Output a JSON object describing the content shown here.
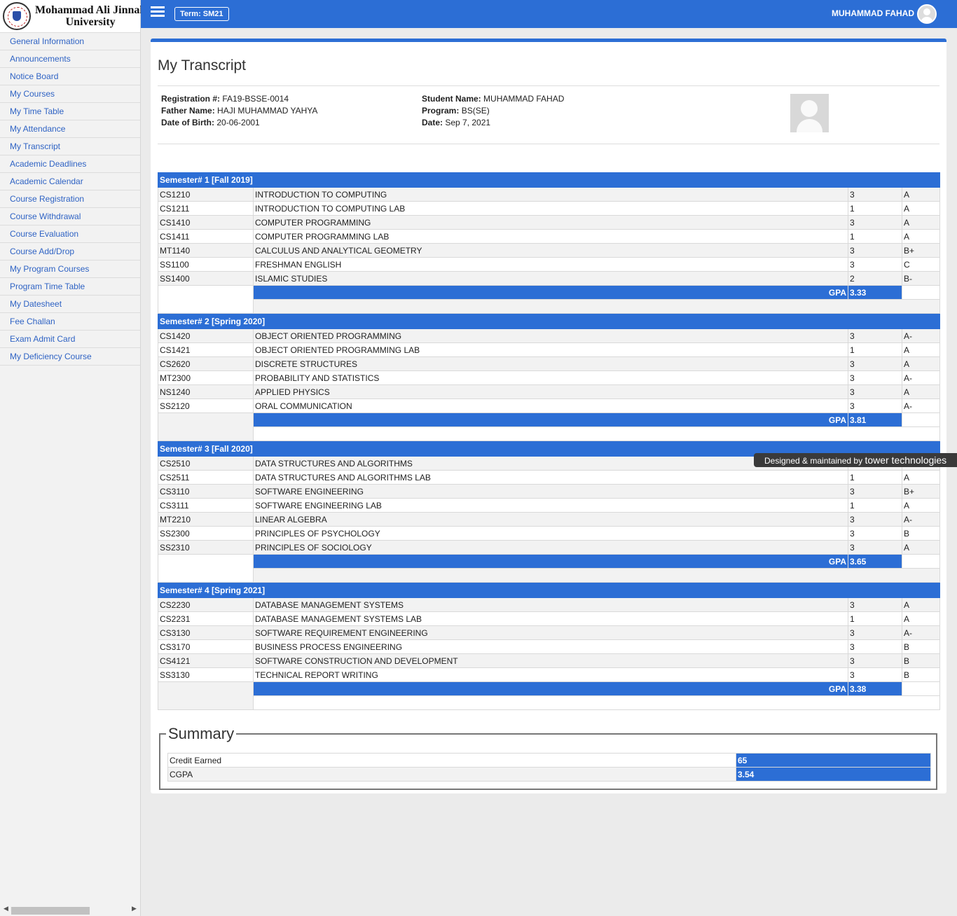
{
  "university": {
    "line1": "Mohammad Ali Jinnah",
    "line2": "University"
  },
  "sidebar": {
    "items": [
      {
        "label": "General Information"
      },
      {
        "label": "Announcements"
      },
      {
        "label": "Notice Board"
      },
      {
        "label": "My Courses"
      },
      {
        "label": "My Time Table"
      },
      {
        "label": "My Attendance"
      },
      {
        "label": "My Transcript"
      },
      {
        "label": "Academic Deadlines"
      },
      {
        "label": "Academic Calendar"
      },
      {
        "label": "Course Registration"
      },
      {
        "label": "Course Withdrawal"
      },
      {
        "label": "Course Evaluation"
      },
      {
        "label": "Course Add/Drop"
      },
      {
        "label": "My Program Courses"
      },
      {
        "label": "Program Time Table"
      },
      {
        "label": "My Datesheet"
      },
      {
        "label": "Fee Challan"
      },
      {
        "label": "Exam Admit Card"
      },
      {
        "label": "My Deficiency Course"
      }
    ]
  },
  "topbar": {
    "term": "Term: SM21",
    "user": "MUHAMMAD FAHAD"
  },
  "page": {
    "title": "My Transcript"
  },
  "student": {
    "reg_label": "Registration #:",
    "reg": "FA19-BSSE-0014",
    "father_label": "Father Name:",
    "father": "HAJI MUHAMMAD YAHYA",
    "dob_label": "Date of Birth:",
    "dob": "20-06-2001",
    "name_label": "Student Name:",
    "name": "MUHAMMAD FAHAD",
    "program_label": "Program:",
    "program": "BS(SE)",
    "date_label": "Date:",
    "date": "Sep 7, 2021"
  },
  "gpa_label": "GPA",
  "semesters": [
    {
      "title": "Semester# 1 [Fall 2019]",
      "gpa": "3.33",
      "courses": [
        {
          "code": "CS1210",
          "name": "INTRODUCTION TO COMPUTING",
          "cr": "3",
          "grade": "A"
        },
        {
          "code": "CS1211",
          "name": "INTRODUCTION TO COMPUTING LAB",
          "cr": "1",
          "grade": "A"
        },
        {
          "code": "CS1410",
          "name": "COMPUTER PROGRAMMING",
          "cr": "3",
          "grade": "A"
        },
        {
          "code": "CS1411",
          "name": "COMPUTER PROGRAMMING LAB",
          "cr": "1",
          "grade": "A"
        },
        {
          "code": "MT1140",
          "name": "CALCULUS AND ANALYTICAL GEOMETRY",
          "cr": "3",
          "grade": "B+"
        },
        {
          "code": "SS1100",
          "name": "FRESHMAN ENGLISH",
          "cr": "3",
          "grade": "C"
        },
        {
          "code": "SS1400",
          "name": "ISLAMIC STUDIES",
          "cr": "2",
          "grade": "B-"
        }
      ]
    },
    {
      "title": "Semester# 2 [Spring 2020]",
      "gpa": "3.81",
      "courses": [
        {
          "code": "CS1420",
          "name": "OBJECT ORIENTED PROGRAMMING",
          "cr": "3",
          "grade": "A-"
        },
        {
          "code": "CS1421",
          "name": "OBJECT ORIENTED PROGRAMMING LAB",
          "cr": "1",
          "grade": "A"
        },
        {
          "code": "CS2620",
          "name": "DISCRETE STRUCTURES",
          "cr": "3",
          "grade": "A"
        },
        {
          "code": "MT2300",
          "name": "PROBABILITY AND STATISTICS",
          "cr": "3",
          "grade": "A-"
        },
        {
          "code": "NS1240",
          "name": "APPLIED PHYSICS",
          "cr": "3",
          "grade": "A"
        },
        {
          "code": "SS2120",
          "name": "ORAL COMMUNICATION",
          "cr": "3",
          "grade": "A-"
        }
      ]
    },
    {
      "title": "Semester# 3 [Fall 2020]",
      "gpa": "3.65",
      "courses": [
        {
          "code": "CS2510",
          "name": "DATA STRUCTURES AND ALGORITHMS",
          "cr": "",
          "grade": ""
        },
        {
          "code": "CS2511",
          "name": "DATA STRUCTURES AND ALGORITHMS LAB",
          "cr": "1",
          "grade": "A"
        },
        {
          "code": "CS3110",
          "name": "SOFTWARE ENGINEERING",
          "cr": "3",
          "grade": "B+"
        },
        {
          "code": "CS3111",
          "name": "SOFTWARE ENGINEERING LAB",
          "cr": "1",
          "grade": "A"
        },
        {
          "code": "MT2210",
          "name": "LINEAR ALGEBRA",
          "cr": "3",
          "grade": "A-"
        },
        {
          "code": "SS2300",
          "name": "PRINCIPLES OF PSYCHOLOGY",
          "cr": "3",
          "grade": "B"
        },
        {
          "code": "SS2310",
          "name": "PRINCIPLES OF SOCIOLOGY",
          "cr": "3",
          "grade": "A"
        }
      ]
    },
    {
      "title": "Semester# 4 [Spring 2021]",
      "gpa": "3.38",
      "courses": [
        {
          "code": "CS2230",
          "name": "DATABASE MANAGEMENT SYSTEMS",
          "cr": "3",
          "grade": "A"
        },
        {
          "code": "CS2231",
          "name": "DATABASE MANAGEMENT SYSTEMS LAB",
          "cr": "1",
          "grade": "A"
        },
        {
          "code": "CS3130",
          "name": "SOFTWARE REQUIREMENT ENGINEERING",
          "cr": "3",
          "grade": "A-"
        },
        {
          "code": "CS3170",
          "name": "BUSINESS PROCESS ENGINEERING",
          "cr": "3",
          "grade": "B"
        },
        {
          "code": "CS4121",
          "name": "SOFTWARE CONSTRUCTION AND DEVELOPMENT",
          "cr": "3",
          "grade": "B"
        },
        {
          "code": "SS3130",
          "name": "TECHNICAL REPORT WRITING",
          "cr": "3",
          "grade": "B"
        }
      ]
    }
  ],
  "summary": {
    "title": "Summary",
    "credit_label": "Credit Earned",
    "credit": "65",
    "cgpa_label": "CGPA",
    "cgpa": "3.54"
  },
  "footer": {
    "designed": "Designed & maintained by",
    "brand": "tower technologies"
  },
  "colors": {
    "accent": "#2c6ed5",
    "link": "#2f63c4"
  }
}
